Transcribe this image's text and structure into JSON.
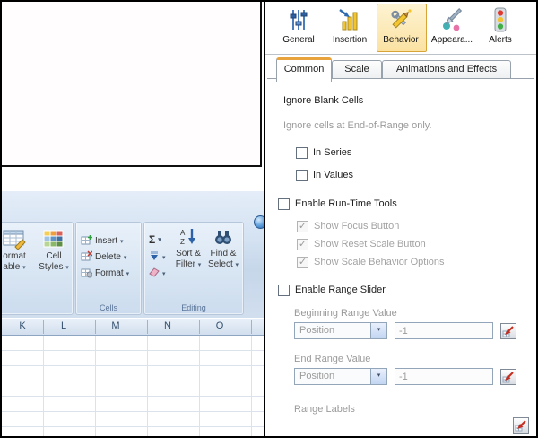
{
  "icons": {
    "caret_down": "▾",
    "check": "✓",
    "toolbar_icon_names": [
      "sliders-icon",
      "chart-insertion-icon",
      "tools-icon",
      "paint-icon",
      "traffic-light-icon"
    ],
    "selector_icon_name": "cell-selector-icon"
  },
  "colors": {
    "selection_orange": "#e9a33c",
    "selected_tool_bg": "#fbe2a2",
    "ribbon_blue": "#d4e2f2",
    "picker_red": "#c62d1f"
  },
  "excel": {
    "ribbon": {
      "format_as_table": {
        "line1": "ormat",
        "line2": "able"
      },
      "cell_styles": {
        "line1": "Cell",
        "line2": "Styles"
      },
      "cells_group": {
        "label": "Cells",
        "insert": "Insert",
        "delete": "Delete",
        "format": "Format"
      },
      "editing_group": {
        "label": "Editing",
        "autosum": "Σ",
        "sort_line1": "Sort &",
        "sort_line2": "Filter",
        "find_line1": "Find &",
        "find_line2": "Select"
      }
    },
    "column_headers": [
      "K",
      "L",
      "M",
      "N",
      "O"
    ]
  },
  "panel": {
    "toolbar": {
      "items": [
        {
          "label": "General",
          "selected": false
        },
        {
          "label": "Insertion",
          "selected": false
        },
        {
          "label": "Behavior",
          "selected": true
        },
        {
          "label": "Appeara...",
          "selected": false
        },
        {
          "label": "Alerts",
          "selected": false
        }
      ]
    },
    "tabs": [
      {
        "label": "Common",
        "selected": true
      },
      {
        "label": "Scale",
        "selected": false
      },
      {
        "label": "Animations and Effects",
        "selected": false
      }
    ],
    "common_tab": {
      "ignore_blank_cells": {
        "title": "Ignore Blank Cells",
        "note": "Ignore cells at End-of-Range only.",
        "in_series": {
          "label": "In Series",
          "checked": false
        },
        "in_values": {
          "label": "In Values",
          "checked": false
        }
      },
      "enable_runtime_tools": {
        "label": "Enable Run-Time Tools",
        "checked": false,
        "options": [
          {
            "label": "Show Focus Button",
            "checked": true,
            "disabled": true
          },
          {
            "label": "Show Reset Scale Button",
            "checked": true,
            "disabled": true
          },
          {
            "label": "Show Scale Behavior Options",
            "checked": true,
            "disabled": true
          }
        ]
      },
      "enable_range_slider": {
        "label": "Enable Range Slider",
        "checked": false,
        "beginning_range_value": {
          "label": "Beginning Range Value",
          "type": "Position",
          "value": "-1"
        },
        "end_range_value": {
          "label": "End Range Value",
          "type": "Position",
          "value": "-1"
        },
        "range_labels": {
          "label": "Range Labels"
        }
      }
    }
  }
}
